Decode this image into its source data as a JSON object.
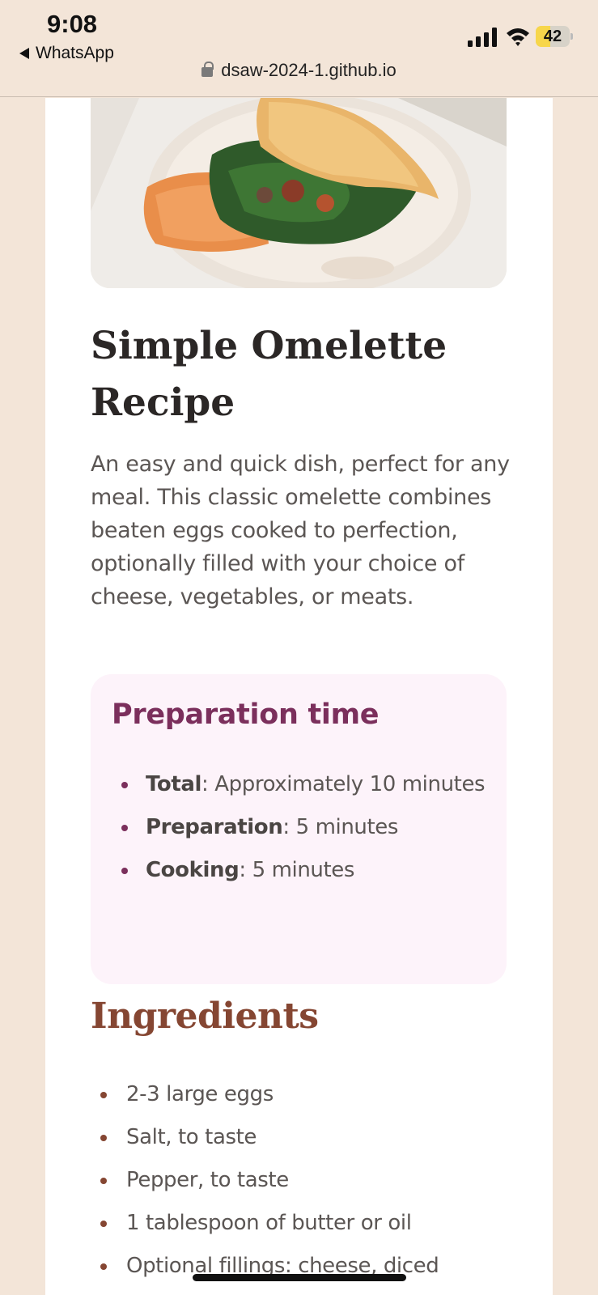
{
  "status_bar": {
    "time": "9:08",
    "back_app": "WhatsApp",
    "battery_level": "42",
    "battery_fraction": 0.42,
    "icons": [
      "signal-icon",
      "wifi-icon",
      "battery-icon",
      "lock-icon"
    ]
  },
  "browser": {
    "url": "dsaw-2024-1.github.io"
  },
  "recipe": {
    "hero_image": "omelette-on-plate-image",
    "title": "Simple Omelette Recipe",
    "intro": "An easy and quick dish, perfect for any meal. This classic omelette combines beaten eggs cooked to perfection, optionally filled with your choice of cheese, vegetables, or meats."
  },
  "preparation": {
    "heading": "Preparation time",
    "items": [
      {
        "label": "Total",
        "value": ": Approximately 10 minutes"
      },
      {
        "label": "Preparation",
        "value": ": 5 minutes"
      },
      {
        "label": "Cooking",
        "value": ": 5 minutes"
      }
    ]
  },
  "ingredients": {
    "heading": "Ingredients",
    "items": [
      "2-3 large eggs",
      "Salt, to taste",
      "Pepper, to taste",
      "1 tablespoon of butter or oil",
      "Optional fillings: cheese, diced"
    ]
  },
  "colors": {
    "page_bg": "#f3e5d8",
    "card_bg": "#ffffff",
    "prep_bg": "#fdf3fa",
    "prep_accent": "#7b2f5c",
    "ingredients_accent": "#854632",
    "body_text": "#5b5654",
    "title_text": "#2b2726"
  }
}
